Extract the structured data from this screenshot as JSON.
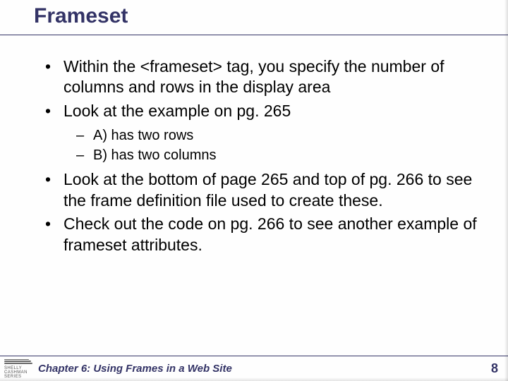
{
  "slide": {
    "title": "Frameset",
    "bullets": [
      {
        "text": "Within the <frameset> tag, you specify the number of columns and rows in the display area"
      },
      {
        "text": "Look at the example on pg. 265",
        "sub": [
          {
            "text": "A) has two rows"
          },
          {
            "text": "B) has two columns"
          }
        ]
      },
      {
        "text": "Look at the bottom of page 265 and top of pg. 266 to see the frame definition file used to create these."
      },
      {
        "text": "Check out the code on pg. 266 to see another example of frameset attributes."
      }
    ]
  },
  "footer": {
    "logo_text": "SHELLY CASHMAN SERIES",
    "chapter": "Chapter 6: Using Frames in a Web Site",
    "page_number": "8"
  }
}
